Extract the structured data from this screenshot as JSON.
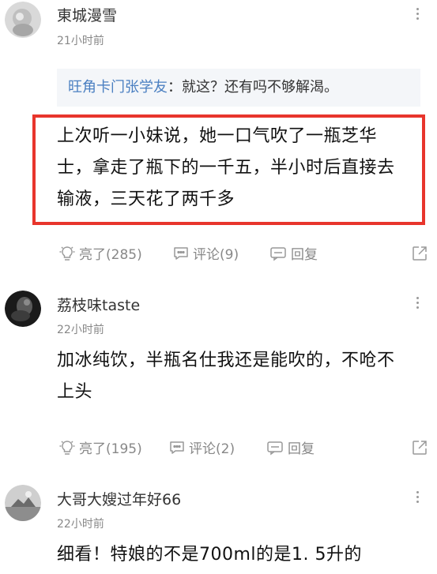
{
  "comments": [
    {
      "username": "東城漫雪",
      "time": "21小时前",
      "quote_name": "旺角卡门张学友",
      "quote_text": "：就这？还有吗不够解渴。",
      "body_lines": [
        "上次听一小妹说，她一口气吹了一瓶芝华",
        "士，拿走了瓶下的一千五，半小时后直接去",
        "输液，三天花了两千多"
      ],
      "like_label": "亮了(285)",
      "comment_label": "评论(9)",
      "reply_label": "回复"
    },
    {
      "username": "荔枝味taste",
      "time": "22小时前",
      "body_lines": [
        "加冰纯饮，半瓶名仕我还是能吹的，不呛不",
        "上头"
      ],
      "like_label": "亮了(195)",
      "comment_label": "评论(2)",
      "reply_label": "回复"
    },
    {
      "username": "大哥大嫂过年好66",
      "time": "22小时前",
      "body_lines": [
        "细看！特娘的不是700ml的是1. 5升的"
      ]
    }
  ],
  "colors": {
    "highlight_border": "#e8352c",
    "quote_name": "#4a7fc1",
    "quote_bg": "#f4f6f9"
  },
  "icons": [
    "more-icon",
    "lightbulb-icon",
    "comment-icon",
    "reply-icon",
    "share-icon"
  ]
}
